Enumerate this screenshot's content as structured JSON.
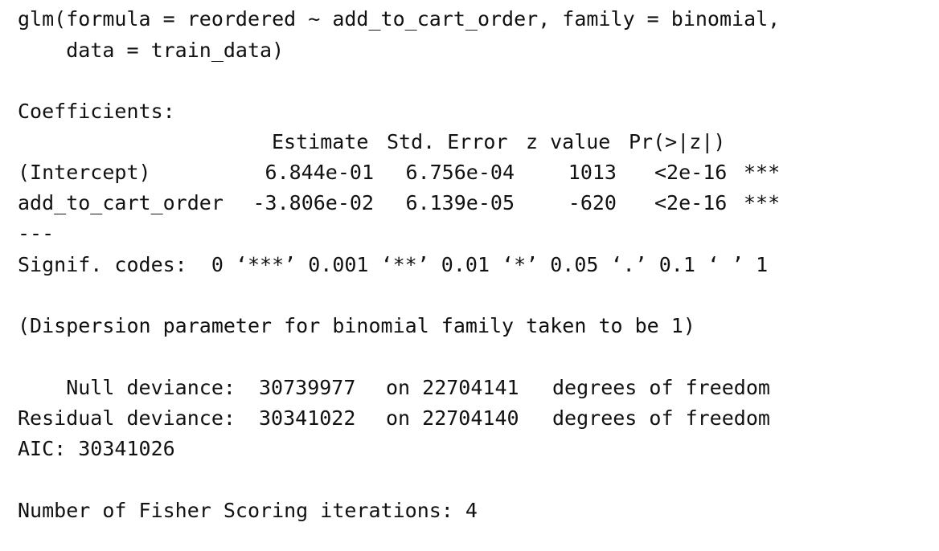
{
  "call": {
    "line1": "glm(formula = reordered ~ add_to_cart_order, family = binomial,",
    "line2": "    data = train_data)"
  },
  "coefficients": {
    "title": "Coefficients:",
    "headers": [
      "Estimate",
      "Std. Error",
      "z value",
      "Pr(>|z|)"
    ],
    "rows": [
      {
        "name": "(Intercept)",
        "estimate": "6.844e-01",
        "std_error": "6.756e-04",
        "z_value": "1013",
        "p_value": "<2e-16",
        "signif": "***"
      },
      {
        "name": "add_to_cart_order",
        "estimate": "-3.806e-02",
        "std_error": "6.139e-05",
        "z_value": "-620",
        "p_value": "<2e-16",
        "signif": "***"
      }
    ],
    "separator": "---",
    "signif_codes": "Signif. codes:  0 ‘***’ 0.001 ‘**’ 0.01 ‘*’ 0.05 ‘.’ 0.1 ‘ ’ 1"
  },
  "dispersion_note": "(Dispersion parameter for binomial family taken to be 1)",
  "deviance": {
    "null": {
      "label": "    Null deviance:",
      "value": "30739977",
      "df_text": "on 22704141",
      "suffix": "degrees of freedom"
    },
    "residual": {
      "label": "Residual deviance:",
      "value": "30341022",
      "df_text": "on 22704140",
      "suffix": "degrees of freedom"
    }
  },
  "aic": "AIC: 30341026",
  "fisher": "Number of Fisher Scoring iterations: 4"
}
